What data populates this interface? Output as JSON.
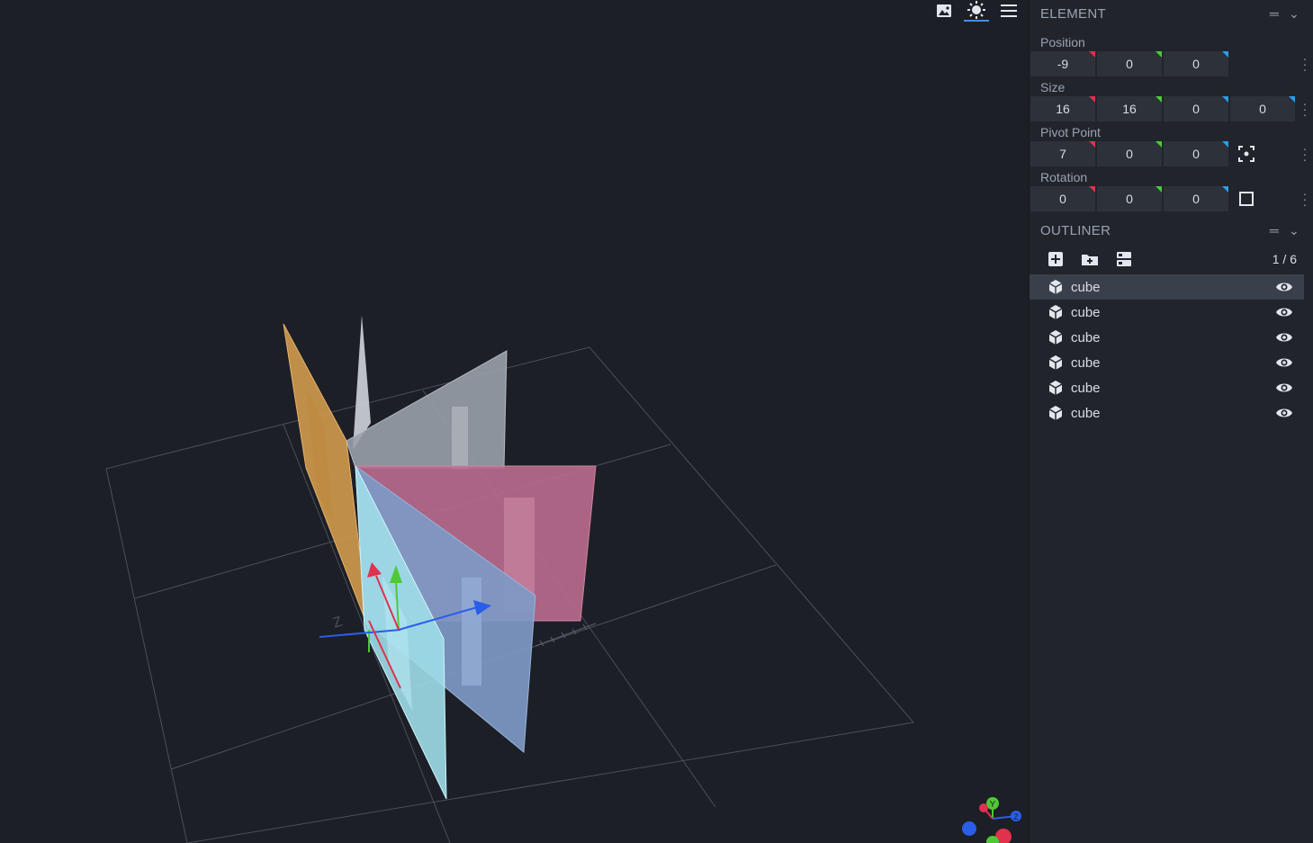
{
  "viewport": {
    "tools": [
      {
        "name": "image-icon",
        "glyph": "🖼",
        "active": false
      },
      {
        "name": "sun-icon",
        "glyph": "☀",
        "active": true
      },
      {
        "name": "menu-icon",
        "glyph": "☰",
        "active": false
      }
    ],
    "axes_gizmo": {
      "y_label": "Y",
      "z_label": "Z",
      "x_label": "X"
    }
  },
  "element_panel": {
    "title": "ELEMENT",
    "position": {
      "label": "Position",
      "values": [
        "-9",
        "0",
        "0"
      ]
    },
    "size": {
      "label": "Size",
      "values": [
        "16",
        "16",
        "0",
        "0"
      ]
    },
    "pivot": {
      "label": "Pivot Point",
      "values": [
        "7",
        "0",
        "0"
      ]
    },
    "rotation": {
      "label": "Rotation",
      "values": [
        "0",
        "0",
        "0"
      ]
    }
  },
  "outliner": {
    "title": "OUTLINER",
    "count": "1 / 6",
    "items": [
      {
        "label": "cube",
        "selected": true
      },
      {
        "label": "cube",
        "selected": false
      },
      {
        "label": "cube",
        "selected": false
      },
      {
        "label": "cube",
        "selected": false
      },
      {
        "label": "cube",
        "selected": false
      },
      {
        "label": "cube",
        "selected": false
      }
    ]
  },
  "colors": {
    "accent": "#3e90ff",
    "axis_x": "#e0314d",
    "axis_y": "#4ec935",
    "axis_z": "#2a9ee9",
    "panel_bg": "#21252b",
    "viewport_bg": "#1c1f26"
  }
}
